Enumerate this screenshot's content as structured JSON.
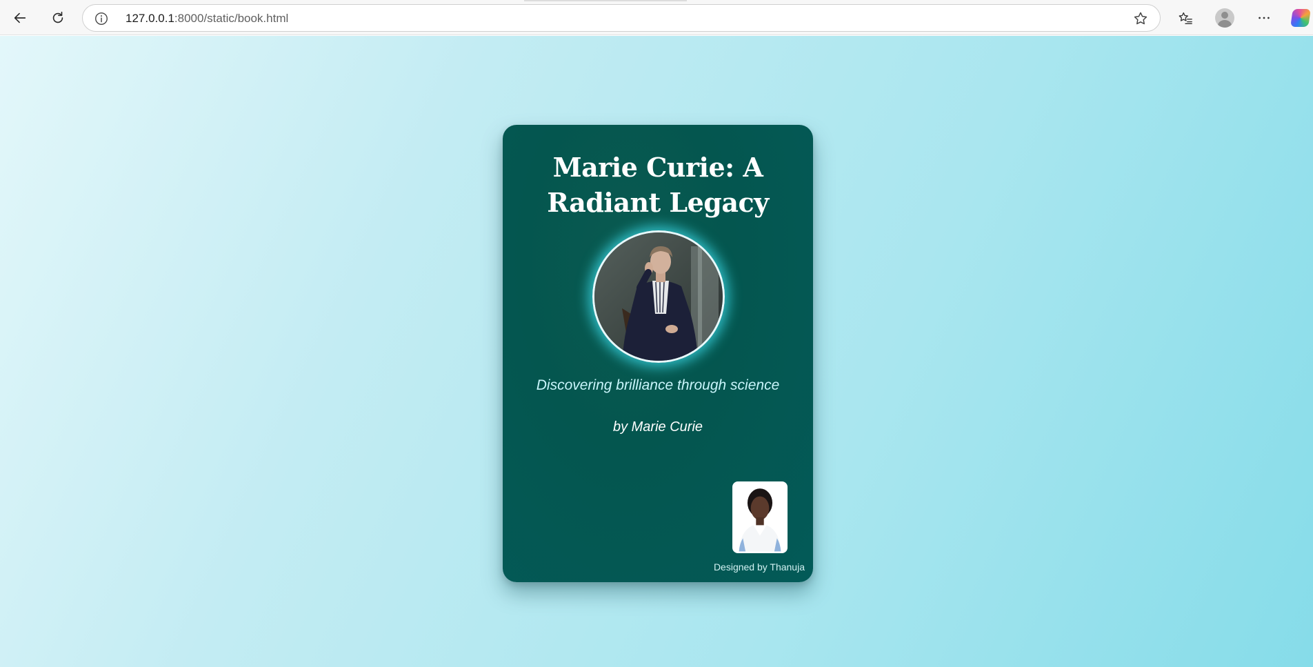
{
  "browser": {
    "url_host": "127.0.0.1",
    "url_path": ":8000/static/book.html",
    "icons": [
      "back-arrow-icon",
      "reload-icon",
      "site-info-icon",
      "favorite-star-icon",
      "favorites-list-icon",
      "profile-icon",
      "more-menu-icon",
      "copilot-icon"
    ]
  },
  "book": {
    "title": "Marie Curie: A Radiant Legacy",
    "subtitle": "Discovering brilliance through science",
    "byline": "by Marie Curie",
    "designer_credit": "Designed by Thanuja"
  },
  "colors": {
    "card_background": "#04564f",
    "title_color": "#ffffff",
    "subtitle_color": "#c9f5fb",
    "glow": "#3cdceb",
    "page_gradient_start": "#e3f7fa",
    "page_gradient_end": "#86dce9"
  }
}
